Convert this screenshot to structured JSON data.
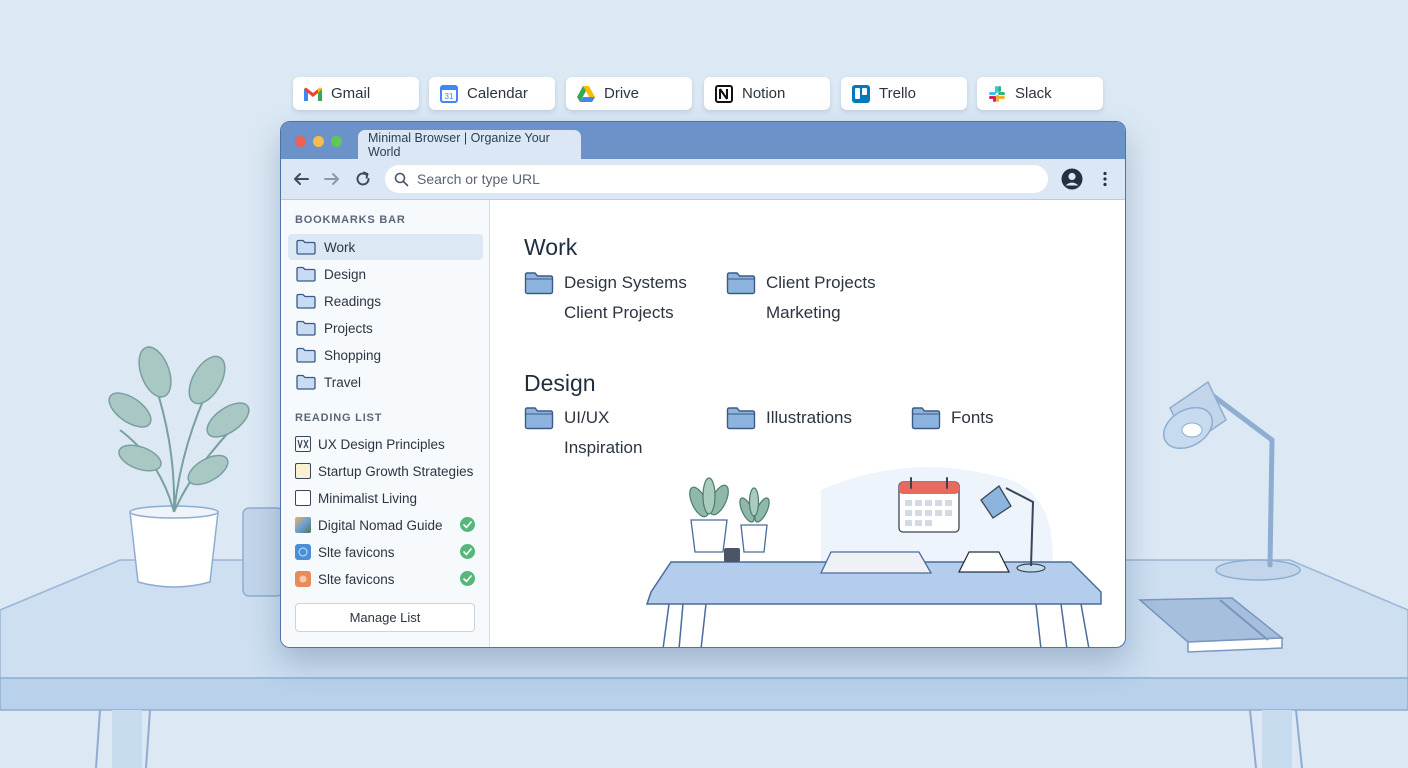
{
  "apps": [
    {
      "label": "Gmail",
      "icon": "gmail-icon"
    },
    {
      "label": "Calendar",
      "icon": "calendar-icon"
    },
    {
      "label": "Drive",
      "icon": "drive-icon"
    },
    {
      "label": "Notion",
      "icon": "notion-icon"
    },
    {
      "label": "Trello",
      "icon": "trello-icon"
    },
    {
      "label": "Slack",
      "icon": "slack-icon"
    }
  ],
  "browser": {
    "tab_title": "Minimal Browser | Organize Your World",
    "search_placeholder": "Search or type URL"
  },
  "sidebar": {
    "bookmarks_heading": "BOOKMARKS BAR",
    "bookmarks": [
      "Work",
      "Design",
      "Readings",
      "Projects",
      "Shopping",
      "Travel"
    ],
    "active_bookmark": "Work",
    "reading_heading": "READING LIST",
    "reading_list": [
      {
        "title": "UX Design Principles",
        "done": false
      },
      {
        "title": "Startup Growth Strategies",
        "done": false
      },
      {
        "title": "Minimalist Living",
        "done": false
      },
      {
        "title": "Digital Nomad Guide",
        "done": true
      },
      {
        "title": "Slte favicons",
        "done": true
      },
      {
        "title": "Slte favicons",
        "done": true
      }
    ],
    "manage_label": "Manage List"
  },
  "main": {
    "work_title": "Work",
    "work_folders": [
      "Design Systems\nClient Projects",
      "Client Projects\nMarketing"
    ],
    "design_title": "Design",
    "design_folders": [
      "UI/UX\nInspiration",
      "Illustrations",
      "Fonts"
    ]
  },
  "colors": {
    "background": "#dce9f5",
    "titlebar": "#6b93c9",
    "toolbar": "#dbe7f5",
    "folder": "#8db4df",
    "check": "#55b87a"
  }
}
